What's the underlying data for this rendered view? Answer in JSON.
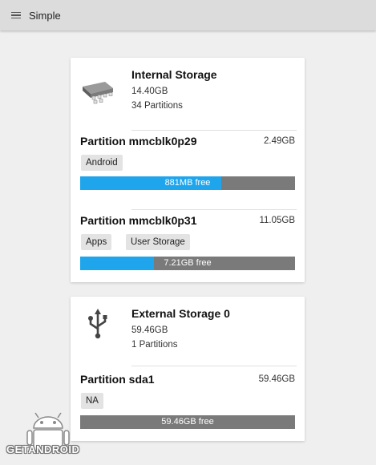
{
  "app": {
    "title": "Simple",
    "menu_icon": "hamburger-menu-icon"
  },
  "devices": [
    {
      "name": "Internal Storage",
      "size": "14.40GB",
      "partitions_text": "34 Partitions",
      "icon": "memory-chip-icon",
      "partitions": [
        {
          "name": "Partition mmcblk0p29",
          "size": "2.49GB",
          "tags": [
            "Android"
          ],
          "free_label": "881MB free",
          "used_fraction": 0.655
        },
        {
          "name": "Partition mmcblk0p31",
          "size": "11.05GB",
          "tags": [
            "Apps",
            "User Storage"
          ],
          "free_label": "7.21GB free",
          "used_fraction": 0.345
        }
      ]
    },
    {
      "name": "External Storage 0",
      "size": "59.46GB",
      "partitions_text": "1 Partitions",
      "icon": "usb-icon",
      "partitions": [
        {
          "name": "Partition sda1",
          "size": "59.46GB",
          "tags": [
            "NA"
          ],
          "free_label": "59.46GB free",
          "used_fraction": 0.0
        }
      ]
    }
  ],
  "watermark": {
    "text": "GETANDROID"
  },
  "colors": {
    "used": "#1ea5ec",
    "free": "#7a7a7a",
    "appbar": "#dcdcdc",
    "background": "#efefef"
  }
}
